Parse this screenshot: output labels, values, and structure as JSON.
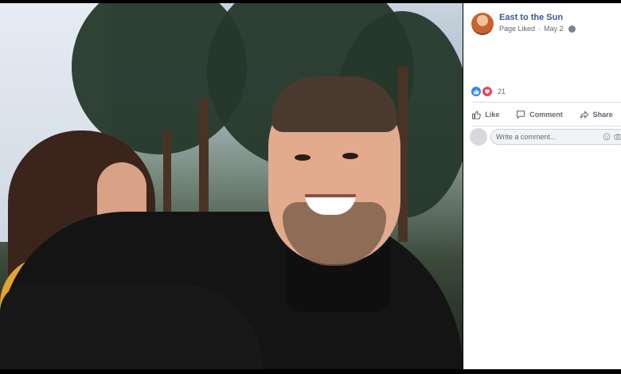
{
  "post": {
    "page_name": "East to the Sun",
    "meta_status": "Page Liked",
    "separator": "·",
    "date": "May 2"
  },
  "reactions": {
    "count": "21",
    "types": [
      "like",
      "love"
    ]
  },
  "actions": {
    "like_label": "Like",
    "comment_label": "Comment",
    "share_label": "Share"
  },
  "comment": {
    "placeholder": "Write a comment..."
  },
  "icons": {
    "globe": "globe-icon",
    "like": "thumbs-up-icon",
    "comment": "speech-bubble-icon",
    "share": "share-arrow-icon",
    "emoji": "emoji-icon",
    "camera": "camera-icon"
  },
  "colors": {
    "brand_link": "#385898",
    "like_blue": "#2d88ff",
    "love_red": "#f33e58"
  }
}
